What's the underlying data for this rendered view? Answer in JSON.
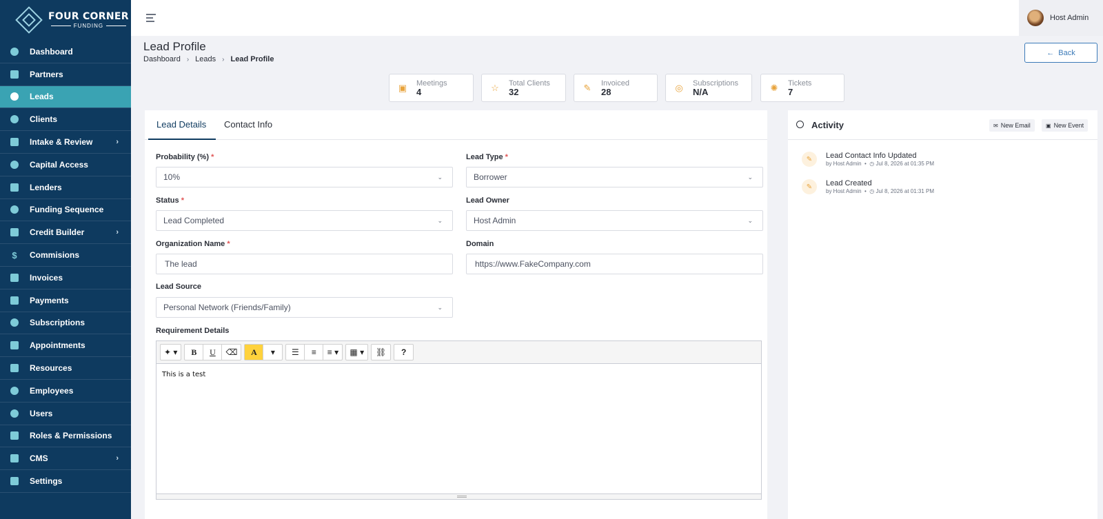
{
  "brand": {
    "title": "FOUR CORNER",
    "subtitle": "FUNDING"
  },
  "sidebar": {
    "items": [
      {
        "label": "Dashboard"
      },
      {
        "label": "Partners"
      },
      {
        "label": "Leads",
        "active": true
      },
      {
        "label": "Clients"
      },
      {
        "label": "Intake & Review",
        "has_children": true
      },
      {
        "label": "Capital Access"
      },
      {
        "label": "Lenders"
      },
      {
        "label": "Funding Sequence"
      },
      {
        "label": "Credit Builder",
        "has_children": true
      },
      {
        "label": "Commisions"
      },
      {
        "label": "Invoices"
      },
      {
        "label": "Payments"
      },
      {
        "label": "Subscriptions"
      },
      {
        "label": "Appointments"
      },
      {
        "label": "Resources"
      },
      {
        "label": "Employees"
      },
      {
        "label": "Users"
      },
      {
        "label": "Roles & Permissions"
      },
      {
        "label": "CMS",
        "has_children": true
      },
      {
        "label": "Settings"
      }
    ]
  },
  "header": {
    "user_name": "Host Admin"
  },
  "page": {
    "title": "Lead Profile",
    "breadcrumb": [
      "Dashboard",
      "Leads",
      "Lead Profile"
    ],
    "back_label": "Back"
  },
  "stats": [
    {
      "label": "Meetings",
      "value": "4",
      "icon": "calendar-icon"
    },
    {
      "label": "Total Clients",
      "value": "32",
      "icon": "star-icon"
    },
    {
      "label": "Invoiced",
      "value": "28",
      "icon": "invoice-icon"
    },
    {
      "label": "Subscriptions",
      "value": "N/A",
      "icon": "subscription-icon"
    },
    {
      "label": "Tickets",
      "value": "7",
      "icon": "ticket-icon"
    }
  ],
  "tabs": [
    {
      "label": "Lead Details",
      "active": true
    },
    {
      "label": "Contact Info"
    }
  ],
  "form": {
    "probability": {
      "label": "Probability (%)",
      "value": "10%"
    },
    "lead_type": {
      "label": "Lead Type",
      "value": "Borrower"
    },
    "status": {
      "label": "Status",
      "value": "Lead Completed"
    },
    "lead_owner": {
      "label": "Lead Owner",
      "value": "Host Admin"
    },
    "org_name": {
      "label": "Organization Name",
      "value": "The lead"
    },
    "domain": {
      "label": "Domain",
      "value": "https://www.FakeCompany.com"
    },
    "lead_source": {
      "label": "Lead Source",
      "value": "Personal Network (Friends/Family)"
    },
    "requirements": {
      "label": "Requirement Details",
      "value": "This is a test"
    },
    "required_mark": "*"
  },
  "activity": {
    "title": "Activity",
    "new_email_label": "New Email",
    "new_event_label": "New Event",
    "items": [
      {
        "title": "Lead Contact Info Updated",
        "by": "by Host Admin",
        "time": "Jul 8, 2026 at 01:35 PM"
      },
      {
        "title": "Lead Created",
        "by": "by Host Admin",
        "time": "Jul 8, 2026 at 01:31 PM"
      }
    ]
  },
  "colors": {
    "sidebar_bg": "#0e3a5f",
    "active_bg": "#3aa3b3",
    "accent": "#e8a33b",
    "link": "#3b7ab8"
  }
}
